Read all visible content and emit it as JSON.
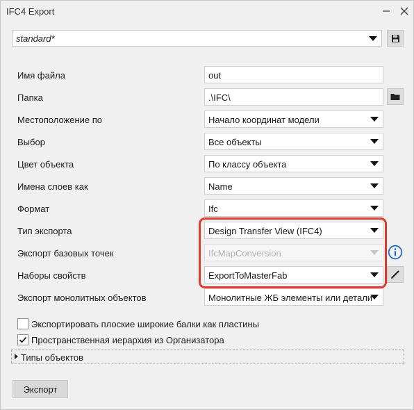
{
  "window": {
    "title": "IFC4 Export"
  },
  "preset": {
    "value": "standard*"
  },
  "rows": [
    {
      "label": "Имя файла",
      "value": "out"
    },
    {
      "label": "Папка",
      "value": ".\\IFC\\"
    },
    {
      "label": "Местоположение по",
      "value": "Начало координат модели"
    },
    {
      "label": "Выбор",
      "value": "Все объекты"
    },
    {
      "label": "Цвет объекта",
      "value": "По классу объекта"
    },
    {
      "label": "Имена слоев как",
      "value": "Name"
    },
    {
      "label": "Формат",
      "value": "Ifc"
    },
    {
      "label": "Тип экспорта",
      "value": "Design Transfer View (IFC4)"
    },
    {
      "label": "Экспорт базовых точек",
      "value": "IfcMapConversion"
    },
    {
      "label": "Наборы свойств",
      "value": "ExportToMasterFab"
    },
    {
      "label": "Экспорт монолитных объектов",
      "value": "Монолитные ЖБ элементы или детали"
    }
  ],
  "checkboxes": [
    {
      "label": "Экспортировать плоские широкие балки как пластины",
      "checked": false
    },
    {
      "label": "Пространственная иерархия из Организатора",
      "checked": true
    }
  ],
  "expander": {
    "label": "Типы объектов"
  },
  "buttons": {
    "export": "Экспорт"
  },
  "colors": {
    "highlight": "#e03a2f",
    "info": "#1f6fd1"
  },
  "icons": [
    "minimize-icon",
    "close-icon",
    "save-icon",
    "folder-icon",
    "info-icon",
    "pencil-icon",
    "check-icon",
    "triangle-right-icon",
    "chevron-down-icon"
  ]
}
